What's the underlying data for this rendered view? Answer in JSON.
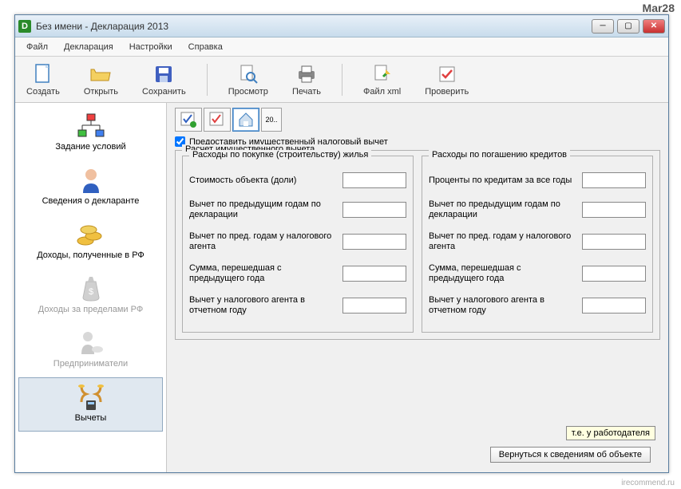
{
  "watermark_top": "Mar28",
  "watermark_bottom": "irecommend.ru",
  "window": {
    "title": "Без имени - Декларация 2013",
    "icon_letter": "D"
  },
  "menu": {
    "file": "Файл",
    "decl": "Декларация",
    "settings": "Настройки",
    "help": "Справка"
  },
  "toolbar": {
    "create": "Создать",
    "open": "Открыть",
    "save": "Сохранить",
    "preview": "Просмотр",
    "print": "Печать",
    "xml": "Файл xml",
    "check": "Проверить"
  },
  "sidebar": {
    "items": [
      {
        "label": "Задание условий"
      },
      {
        "label": "Сведения о декларанте"
      },
      {
        "label": "Доходы, полученные в РФ"
      },
      {
        "label": "Доходы за пределами РФ"
      },
      {
        "label": "Предприниматели"
      },
      {
        "label": "Вычеты"
      }
    ]
  },
  "content": {
    "tab4_text": "20..",
    "checkbox_label": "Предоставить имущественный налоговый вычет",
    "fieldset_title": "Расчет имущественного вычета",
    "col1_title": "Расходы по покупке (строительству) жилья",
    "col2_title": "Расходы по погашению кредитов",
    "col1_fields": [
      "Стоимость объекта (доли)",
      "Вычет по предыдущим годам по декларации",
      "Вычет по пред. годам у налогового агента",
      "Сумма, перешедшая с предыдущего года",
      "Вычет у налогового агента в отчетном году"
    ],
    "col2_fields": [
      "Проценты по кредитам за все годы",
      "Вычет по предыдущим годам по декларации",
      "Вычет по пред. годам у налогового агента",
      "Сумма, перешедшая с предыдущего года",
      "Вычет у налогового агента в отчетном году"
    ],
    "tooltip": "т.е. у работодателя",
    "return_button": "Вернуться к сведениям об объекте"
  }
}
